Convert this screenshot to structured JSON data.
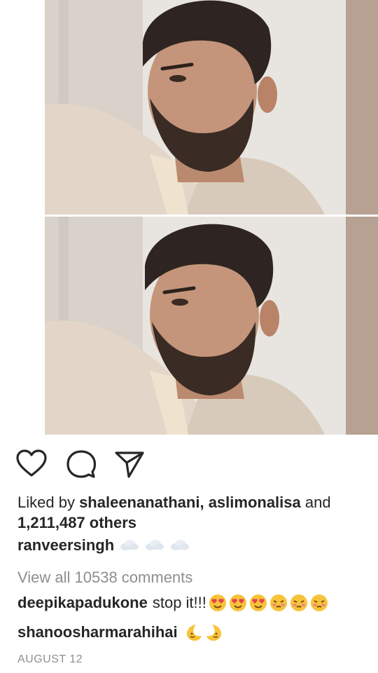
{
  "post": {
    "images": [
      "portrait-photo-top",
      "portrait-photo-bottom"
    ]
  },
  "actions": {
    "like_icon": "heart-outline-icon",
    "comment_icon": "comment-bubble-icon",
    "share_icon": "paper-plane-icon"
  },
  "likes": {
    "prefix": "Liked by ",
    "user1": "shaleenanathani",
    "separator": ", ",
    "user2": "aslimonalisa",
    "and": " and",
    "others": "1,211,487 others"
  },
  "caption": {
    "username": "ranveersingh",
    "emojis": [
      "cloud",
      "cloud",
      "cloud"
    ]
  },
  "comments": {
    "view_all": "View all 10538 comments",
    "items": [
      {
        "username": "deepikapadukone",
        "text": "stop it!!!",
        "emojis": [
          "heart-eyes",
          "heart-eyes",
          "heart-eyes",
          "blushing",
          "blushing",
          "blushing"
        ]
      },
      {
        "username": "shanoosharmarahihai",
        "text": "",
        "emojis": [
          "crescent-moon-face",
          "crescent-moon-face"
        ]
      }
    ]
  },
  "date": "AUGUST 12",
  "colors": {
    "text": "#262626",
    "muted": "#8e8e8e",
    "emoji_yellow": "#f7c33a",
    "emoji_red": "#e4424f"
  }
}
